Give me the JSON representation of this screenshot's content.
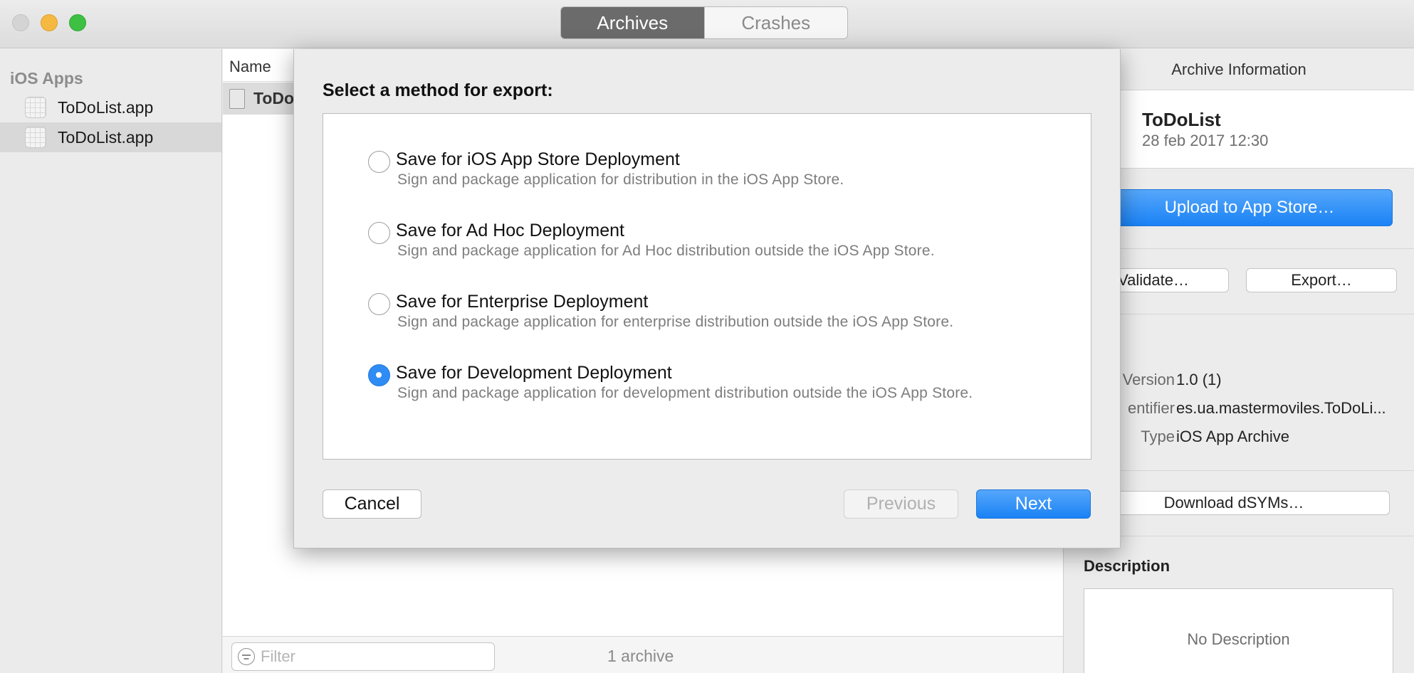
{
  "toolbar": {
    "segments": [
      "Archives",
      "Crashes"
    ]
  },
  "sidebar": {
    "heading": "iOS Apps",
    "items": [
      {
        "label": "ToDoList.app"
      },
      {
        "label": "ToDoList.app"
      }
    ]
  },
  "list": {
    "column_name": "Name",
    "row_label": "ToDo",
    "filter_placeholder": "Filter",
    "archive_count": "1 archive"
  },
  "inspector": {
    "title": "Archive Information",
    "archive_name": "ToDoList",
    "archive_date": "28 feb 2017 12:30",
    "upload_button": "Upload to App Store…",
    "validate_button": "Validate…",
    "export_button": "Export…",
    "details_heading": "ils",
    "properties": [
      {
        "key": "Version",
        "value": "1.0 (1)"
      },
      {
        "key": "entifier",
        "value": "es.ua.mastermoviles.ToDoLi..."
      },
      {
        "key": "Type",
        "value": "iOS App Archive"
      }
    ],
    "download_button": "Download dSYMs…",
    "description_heading": "Description",
    "description_text": "No Description"
  },
  "sheet": {
    "title": "Select a method for export:",
    "options": [
      {
        "title": "Save for iOS App Store Deployment",
        "description": "Sign and package application for distribution in the iOS App Store.",
        "selected": false
      },
      {
        "title": "Save for Ad Hoc Deployment",
        "description": "Sign and package application for Ad Hoc distribution outside the iOS App Store.",
        "selected": false
      },
      {
        "title": "Save for Enterprise Deployment",
        "description": "Sign and package application for enterprise distribution outside the iOS App Store.",
        "selected": false
      },
      {
        "title": "Save for Development Deployment",
        "description": "Sign and package application for development distribution outside the iOS App Store.",
        "selected": true
      }
    ],
    "cancel_button": "Cancel",
    "previous_button": "Previous",
    "next_button": "Next"
  },
  "colors": {
    "accent": "#1a82f5",
    "segment_active": "#6b6b6b"
  }
}
